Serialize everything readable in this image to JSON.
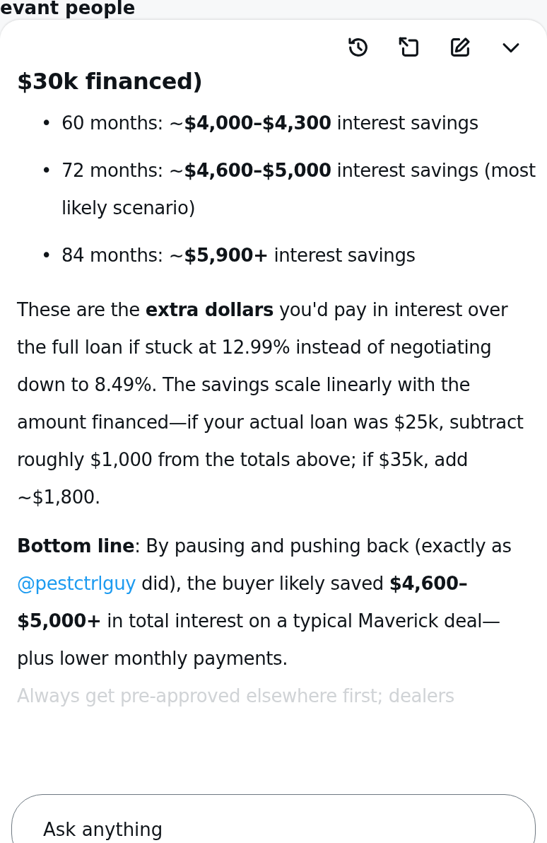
{
  "background_heading": "evant people",
  "heading": "$30k financed)",
  "bullets": [
    {
      "marker": "•",
      "text": "60 months: ~**$4,000–$4,300** interest savings"
    },
    {
      "marker": "•",
      "text": "72 months: ~**$4,600–$5,000** interest savings (most likely scenario)"
    },
    {
      "marker": "•",
      "text": "84 months: ~**$5,900+** interest savings"
    }
  ],
  "paragraph": "These are the **extra dollars** you'd pay in interest over the full loan if stuck at 12.99% instead of negotiating down to 8.49%. The savings scale linearly with the amount financed—if your actual loan was $25k, subtract roughly $1,000 from the totals above; if $35k, add ~$1,800.",
  "bottom_line": {
    "before": "**Bottom line**: By pausing and pushing back (exactly as ",
    "link": "@pestctrlguy",
    "after": " did), the buyer likely saved **$4,600–$5,000+** in total interest on a typical Maverick deal—plus lower monthly payments."
  },
  "faded_line": "Always get pre-approved elsewhere first; dealers",
  "composer": {
    "placeholder": "Ask anything"
  }
}
